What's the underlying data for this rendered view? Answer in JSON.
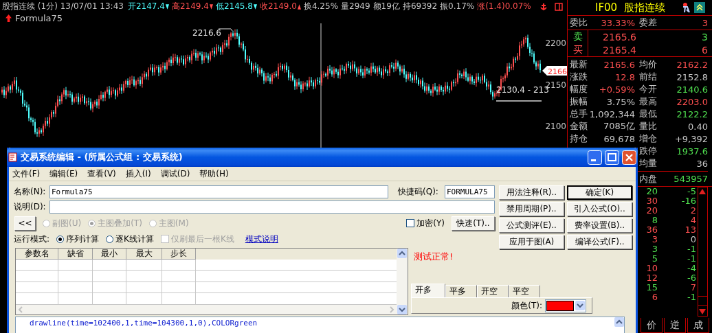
{
  "quote_bar": {
    "title": "股指连续 (1分) 13/07/01 13:43",
    "fields": [
      {
        "text": "开2147.4",
        "color": "#50ffff",
        "rising": false
      },
      {
        "text": "高2149.4",
        "color": "#ff5050",
        "rising": false
      },
      {
        "text": "低2145.8",
        "color": "#50ffff",
        "rising": false
      },
      {
        "text": "收2149.0",
        "color": "#ff5050",
        "rising": true
      },
      {
        "text": "换4.25%",
        "color": "#c8c8c8"
      },
      {
        "text": "量2949",
        "color": "#c8c8c8"
      },
      {
        "text": "额19亿",
        "color": "#c8c8c8"
      },
      {
        "text": "持69392",
        "color": "#c8c8c8"
      },
      {
        "text": "振0.17%",
        "color": "#c8c8c8"
      },
      {
        "text": "涨(1.4)0.07%",
        "color": "#ff5050"
      }
    ]
  },
  "chart": {
    "indicator": "Formula75",
    "y_labels": [
      "2200",
      "2150",
      "2100"
    ],
    "high_label": "2216.6",
    "line_label": "2130.4 - 213",
    "price_tag": "2166"
  },
  "panel": {
    "symbol": "IF00",
    "name": "股指连续",
    "ratio": [
      {
        "label": "委比",
        "value": "33.33%",
        "color": "#ff5050"
      },
      {
        "label": "委差",
        "value": "3",
        "color": "#ff5050"
      }
    ],
    "orders": [
      {
        "side": "卖",
        "kind": "sell",
        "price": "2165.6",
        "volume": "3"
      },
      {
        "side": "买",
        "kind": "buy",
        "price": "2165.4",
        "volume": "6"
      }
    ],
    "quotes": [
      {
        "left": {
          "label": "最新",
          "value": "2165.6",
          "color": "#ff5050"
        },
        "right": {
          "label": "均价",
          "value": "2162.2",
          "color": "#ff5050"
        }
      },
      {
        "left": {
          "label": "涨跌",
          "value": "12.8",
          "color": "#ff5050"
        },
        "right": {
          "label": "前结",
          "value": "2152.8",
          "color": "#c8c8c8"
        }
      },
      {
        "left": {
          "label": "幅度",
          "value": "+0.59%",
          "color": "#ff5050"
        },
        "right": {
          "label": "今开",
          "value": "2140.6",
          "color": "#50e050"
        }
      },
      {
        "left": {
          "label": "振幅",
          "value": "3.75%",
          "color": "#c8c8c8"
        },
        "right": {
          "label": "最高",
          "value": "2203.0",
          "color": "#ff5050"
        }
      },
      {
        "left": {
          "label": "总手",
          "value": "1,092,344",
          "color": "#c8c8c8"
        },
        "right": {
          "label": "最低",
          "value": "2122.2",
          "color": "#50e050"
        }
      },
      {
        "left": {
          "label": "金额",
          "value": "7085亿",
          "color": "#c8c8c8"
        },
        "right": {
          "label": "量比",
          "value": "0.40",
          "color": "#c8c8c8"
        }
      },
      {
        "left": {
          "label": "持仓",
          "value": "69,678",
          "color": "#c8c8c8"
        },
        "right": {
          "label": "增仓",
          "value": "+9,392",
          "color": "#c8c8c8"
        }
      },
      {
        "right": {
          "label": "跌停",
          "value": "1937.6",
          "color": "#50e050"
        }
      },
      {
        "right": {
          "label": "均量",
          "value": "36",
          "color": "#c8c8c8"
        }
      },
      {
        "right": {
          "label": "内盘",
          "value": "543957",
          "color": "#50e050"
        }
      }
    ],
    "ticks": [
      {
        "volume": {
          "text": "20",
          "color": "#50e050"
        },
        "change": {
          "text": "-5",
          "color": "#50e050"
        }
      },
      {
        "volume": {
          "text": "30",
          "color": "#ff5050"
        },
        "change": {
          "text": "-16",
          "color": "#50e050"
        }
      },
      {
        "volume": {
          "text": "20",
          "color": "#ff5050"
        },
        "change": {
          "text": "2",
          "color": "#ff5050"
        }
      },
      {
        "volume": {
          "text": "8",
          "color": "#50e050"
        },
        "change": {
          "text": "4",
          "color": "#ff5050"
        }
      },
      {
        "volume": {
          "text": "36",
          "color": "#ff5050"
        },
        "change": {
          "text": "13",
          "color": "#ff5050"
        }
      },
      {
        "volume": {
          "text": "3",
          "color": "#ff5050"
        },
        "change": {
          "text": "0",
          "color": "#c8c8c8"
        }
      },
      {
        "volume": {
          "text": "3",
          "color": "#50e050"
        },
        "change": {
          "text": "-1",
          "color": "#50e050"
        }
      },
      {
        "volume": {
          "text": "5",
          "color": "#50e050"
        },
        "change": {
          "text": "-1",
          "color": "#50e050"
        }
      },
      {
        "volume": {
          "text": "10",
          "color": "#ff5050"
        },
        "change": {
          "text": "-4",
          "color": "#50e050"
        }
      },
      {
        "volume": {
          "text": "12",
          "color": "#ff5050"
        },
        "change": {
          "text": "-6",
          "color": "#50e050"
        }
      },
      {
        "volume": {
          "text": "15",
          "color": "#50e050"
        },
        "change": {
          "text": "7",
          "color": "#ff5050"
        }
      },
      {
        "volume": {
          "text": "6",
          "color": "#ff5050"
        },
        "change": {
          "text": "-1",
          "color": "#50e050"
        }
      }
    ],
    "tabs": [
      "价",
      "逆",
      "成"
    ]
  },
  "dialog": {
    "title": "交易系统编辑 - (所属公式组 : 交易系统)",
    "menu": [
      "文件(F)",
      "编辑(E)",
      "查看(V)",
      "插入(I)",
      "调试(D)",
      "帮助(H)"
    ],
    "name_label": "名称(N):",
    "name_value": "Formula75",
    "shortcut_label": "快捷码(Q):",
    "shortcut_value": "FORMULA75",
    "desc_label": "说明(D):",
    "collapse_button": "<<",
    "chart_modes": [
      {
        "label": "副图(U)",
        "selected": false,
        "disabled": true
      },
      {
        "label": "主图叠加(T)",
        "selected": true,
        "disabled": true
      },
      {
        "label": "主图(M)",
        "selected": false,
        "disabled": true
      }
    ],
    "encrypt": {
      "label": "加密(Y)",
      "checked": false
    },
    "quick_button": "快速(T)..",
    "run_mode_label": "运行模式:",
    "run_modes": [
      {
        "label": "序列计算",
        "selected": true
      },
      {
        "label": "逐K线计算",
        "selected": false
      }
    ],
    "refresh_last": {
      "label": "仅刷最后一根K线",
      "checked": false,
      "disabled": true
    },
    "mode_help_link": "模式说明",
    "buttons": [
      {
        "label": "用法注释(R)..",
        "default": false
      },
      {
        "label": "确定(K)",
        "default": true
      },
      {
        "label": "禁用周期(P)..",
        "default": false
      },
      {
        "label": "引入公式(O)..",
        "default": false
      },
      {
        "label": "公式测评(E)..",
        "default": false
      },
      {
        "label": "费率设置(B)..",
        "default": false
      },
      {
        "label": "应用于图(A)",
        "default": false
      },
      {
        "label": "编译公式(F)..",
        "default": false
      }
    ],
    "param_table": {
      "columns": [
        "参数名",
        "缺省",
        "最小",
        "最大",
        "步长"
      ]
    },
    "status": "测试正常!",
    "signal_tabs": [
      {
        "label": "开多",
        "selected": true
      },
      {
        "label": "平多",
        "selected": false
      },
      {
        "label": "开空",
        "selected": false
      },
      {
        "label": "平空",
        "selected": false
      }
    ],
    "signal_color": {
      "label": "颜色(T):",
      "color": "#ff0000"
    },
    "code": "drawline(time=102400,1,time=104300,1,0),COLORgreen"
  }
}
